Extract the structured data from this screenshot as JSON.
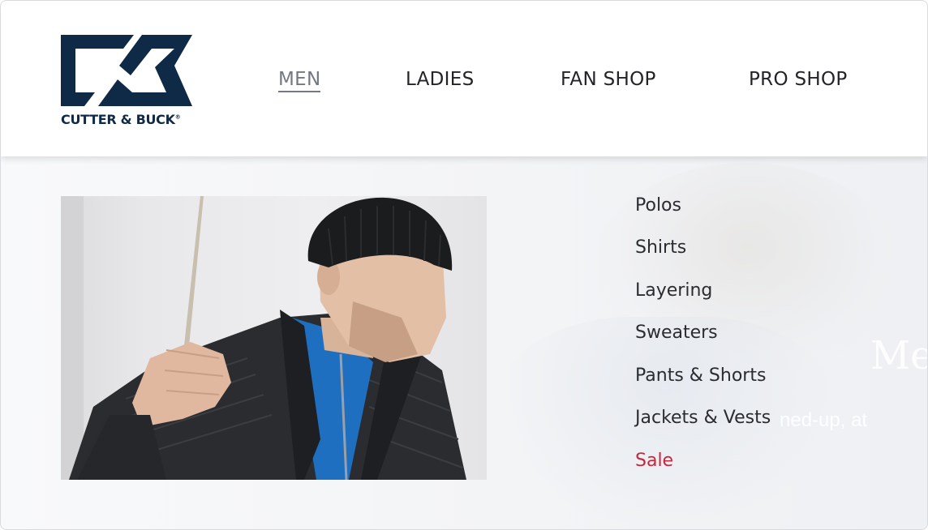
{
  "brand": {
    "name": "CUTTER & BUCK",
    "trademark": "®",
    "color": "#0e2a47"
  },
  "nav": {
    "items": [
      {
        "label": "MEN",
        "active": true
      },
      {
        "label": "LADIES",
        "active": false
      },
      {
        "label": "FAN SHOP",
        "active": false
      },
      {
        "label": "PRO SHOP",
        "active": false
      }
    ]
  },
  "dropdown": {
    "categories": [
      {
        "label": "Polos"
      },
      {
        "label": "Shirts"
      },
      {
        "label": "Layering"
      },
      {
        "label": "Sweaters"
      },
      {
        "label": "Pants & Shorts"
      },
      {
        "label": "Jackets & Vests"
      },
      {
        "label": "Sale"
      }
    ],
    "sale_color": "#c8263b"
  },
  "background": {
    "hero_title_fragment": "Me",
    "hero_sub_fragment": "ned-up, at"
  },
  "colors": {
    "nav_active": "#747881",
    "text_dark": "#222428"
  }
}
